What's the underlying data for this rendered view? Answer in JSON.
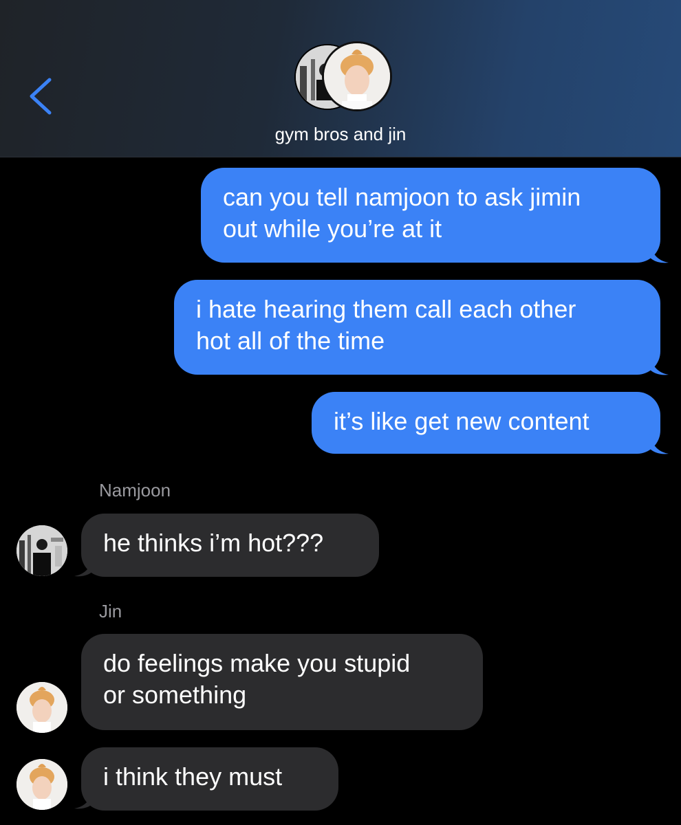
{
  "header": {
    "title": "gym bros and jin",
    "back_icon": "chevron-left-icon",
    "accent": "#3b82f6"
  },
  "messages": [
    {
      "direction": "outgoing",
      "text": "can you tell namjoon to ask jimin\nout while you’re at it"
    },
    {
      "direction": "outgoing",
      "text": "i hate hearing them call each other\nhot all of the time"
    },
    {
      "direction": "outgoing",
      "text": "it’s like get new content"
    },
    {
      "direction": "incoming",
      "sender": "Namjoon",
      "text": "he thinks i’m hot???"
    },
    {
      "direction": "incoming",
      "sender": "Jin",
      "text": "do feelings make you stupid\nor something"
    },
    {
      "direction": "incoming",
      "text": "i think they must"
    }
  ],
  "colors": {
    "outgoing_bubble": "#3b82f6",
    "incoming_bubble": "#2c2c2e",
    "sender_label": "#9a9a9f",
    "background": "#000000"
  }
}
